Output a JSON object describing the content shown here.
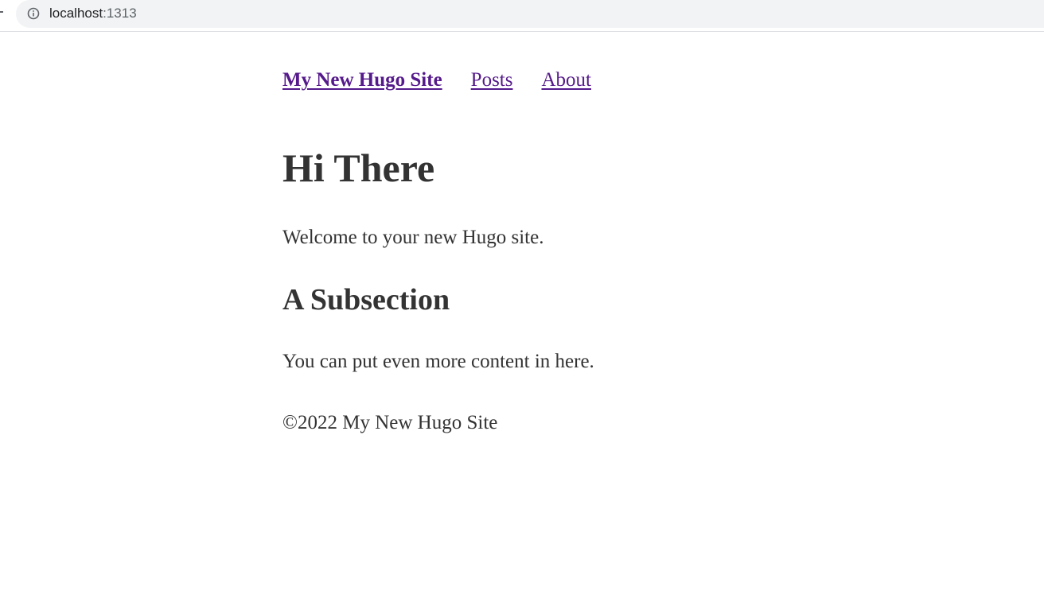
{
  "browser": {
    "url_host": "localhost",
    "url_port": ":1313",
    "icons": [
      "info-icon"
    ]
  },
  "nav": {
    "site_title": "My New Hugo Site",
    "items": [
      {
        "label": "Posts"
      },
      {
        "label": "About"
      }
    ]
  },
  "main": {
    "title": "Hi There",
    "intro": "Welcome to your new Hugo site.",
    "subsection_title": "A Subsection",
    "subsection_text": "You can put even more content in here."
  },
  "footer": {
    "copyright": "©2022 My New Hugo Site"
  },
  "colors": {
    "link": "#551a8b",
    "text": "#333333",
    "omnibox": "#f1f3f4"
  }
}
